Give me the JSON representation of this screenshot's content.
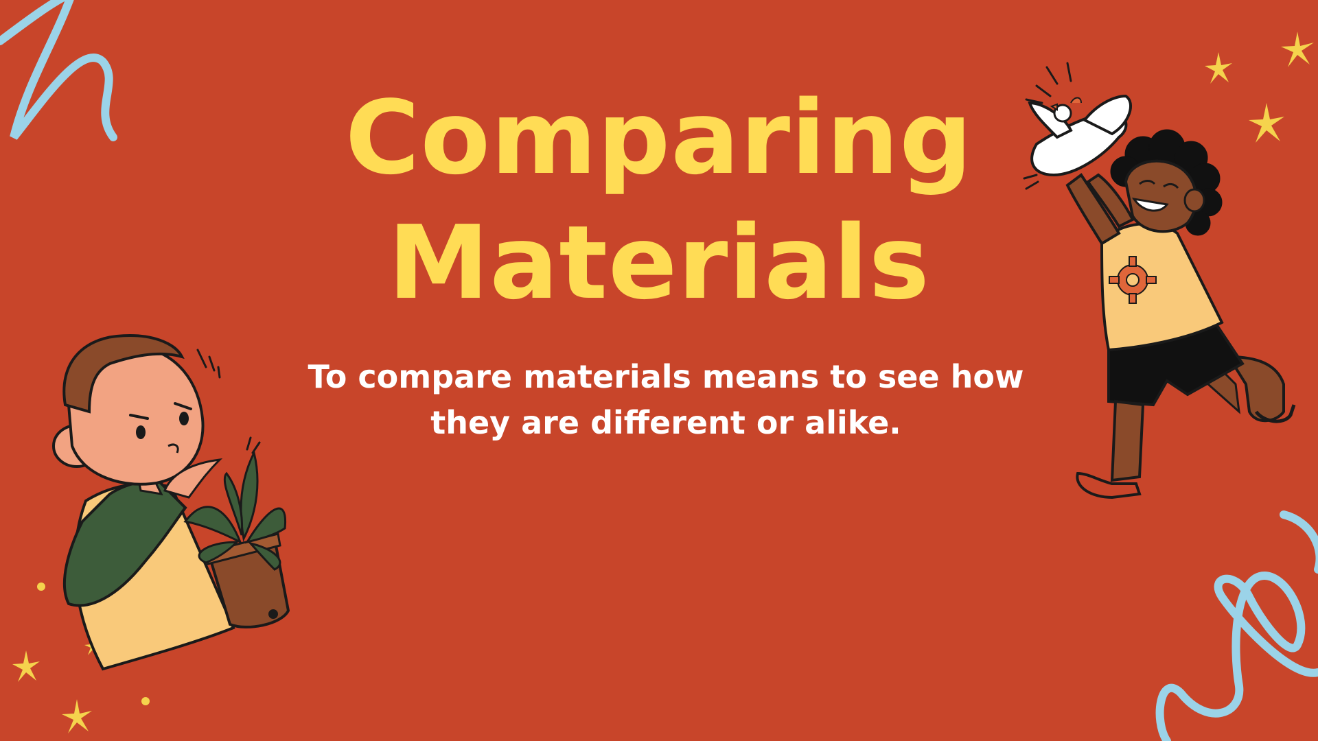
{
  "slide": {
    "title_line1": "Comparing",
    "title_line2": "Materials",
    "subtitle": "To compare materials means to see how they are different or alike."
  },
  "theme": {
    "background": "#C8452A",
    "title_color": "#FFDC55",
    "text_color": "#FFFFFF",
    "squiggle_color": "#9BD3E8",
    "star_color": "#F5D34D"
  },
  "illustrations": {
    "left": "boy-with-plant-illustration",
    "right": "girl-releasing-dove-illustration",
    "accents": [
      "blue-squiggle-icon",
      "sparkle-star-icon"
    ]
  }
}
